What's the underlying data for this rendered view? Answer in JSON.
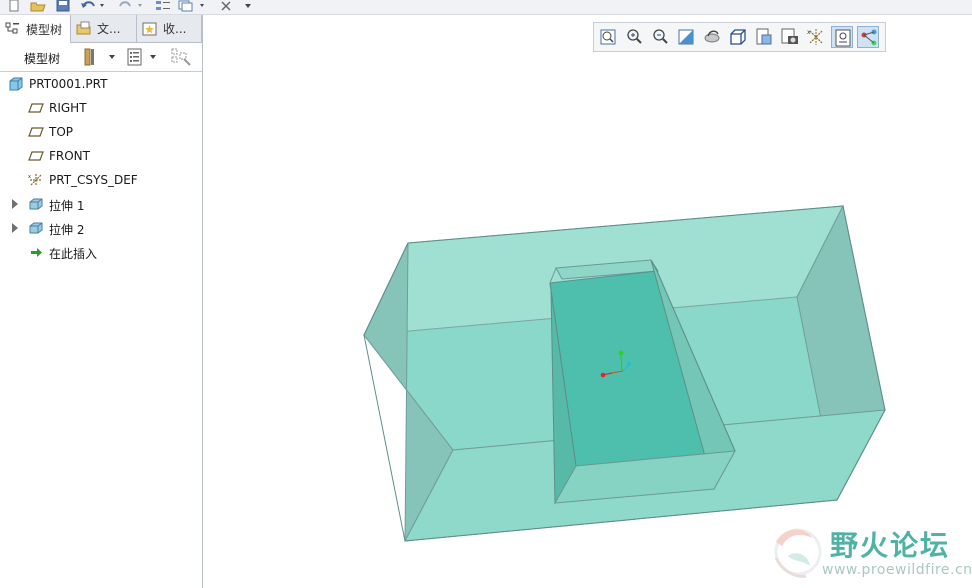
{
  "left_panel": {
    "tabs": [
      {
        "label": "模型树",
        "icon": "model-tree-icon"
      },
      {
        "label": "文...",
        "icon": "folder-browser-icon"
      },
      {
        "label": "收...",
        "icon": "favorites-icon"
      }
    ],
    "toolbar": {
      "label": "模型树",
      "settings_icon": "tools-icon",
      "show_icon": "show-list-icon",
      "filter_icon": "filter-icon"
    }
  },
  "tree": {
    "items": [
      {
        "label": "PRT0001.PRT",
        "icon": "part-icon",
        "expandable": false
      },
      {
        "label": "RIGHT",
        "icon": "datum-plane-icon",
        "expandable": false
      },
      {
        "label": "TOP",
        "icon": "datum-plane-icon",
        "expandable": false
      },
      {
        "label": "FRONT",
        "icon": "datum-plane-icon",
        "expandable": false
      },
      {
        "label": "PRT_CSYS_DEF",
        "icon": "csys-icon",
        "expandable": false
      },
      {
        "label": "拉伸 1",
        "icon": "extrude-icon",
        "expandable": true
      },
      {
        "label": "拉伸 2",
        "icon": "extrude-icon",
        "expandable": true
      },
      {
        "label": "在此插入",
        "icon": "insert-arrow-icon",
        "expandable": false
      }
    ]
  },
  "view_toolbar": {
    "buttons": [
      {
        "name": "refit-icon"
      },
      {
        "name": "zoom-in-icon"
      },
      {
        "name": "zoom-out-icon"
      },
      {
        "name": "repaint-icon"
      },
      {
        "name": "spin-center-icon"
      },
      {
        "name": "display-style-icon"
      },
      {
        "name": "saved-orientations-icon"
      },
      {
        "name": "view-manager-icon"
      },
      {
        "name": "datum-display-icon"
      },
      {
        "name": "annotation-display-icon",
        "active": true
      },
      {
        "name": "spin-center-toggle-icon",
        "active": true
      }
    ]
  },
  "watermark": {
    "title": "野火论坛",
    "url": "www.proewildfire.cn"
  },
  "colors": {
    "model_fill": "#7fd6c6",
    "model_edge": "#5c8f88",
    "accent": "#4fb3a4"
  }
}
